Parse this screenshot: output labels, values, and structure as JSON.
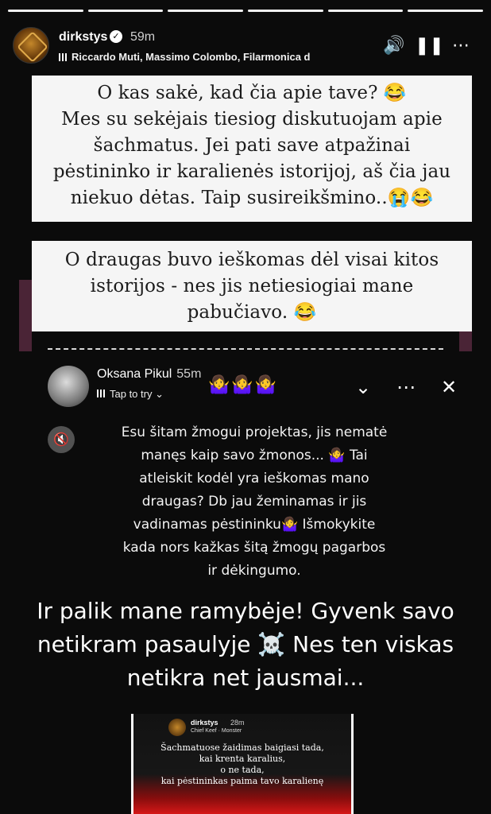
{
  "story": {
    "segments": 6,
    "username": "dirkstys",
    "time": "59m",
    "music": "Riccardo Muti, Massimo Colombo, Filarmonica d",
    "icons": {
      "sound": "volume-icon",
      "pause": "pause-icon",
      "more": "more-icon"
    }
  },
  "card1": [
    "O kas sakė, kad čia apie tave? 😂",
    "Mes su sekėjais tiesiog diskutuojam apie",
    "šachmatus. Jei pati save atpažinai",
    "pėstininko ir karalienės istorijoj, aš čia jau",
    "niekuo dėtas. Taip susireikšmino..😭😂"
  ],
  "card2": [
    "O draugas buvo ieškomas dėl visai kitos",
    "istorijos - nes jis netiesiogiai mane",
    "pabučiavo. 😂"
  ],
  "repost": {
    "username": "Oksana Pikul",
    "time": "55m",
    "emojis": "🤷‍♀️🤷‍♀️🤷‍♀️",
    "tap": "Tap to try",
    "paragraph": [
      "Esu šitam žmogui projektas, jis nematė",
      "manęs kaip savo žmonos... 🤷‍♀️ Tai",
      "atleiskit kodėl yra ieškomas mano",
      "draugas? Db jau žeminamas ir jis",
      "vadinamas pėstininku🤷‍♀️ Išmokykite",
      "kada nors kažkas šitą žmogų pagarbos",
      "ir dėkingumo."
    ],
    "big": [
      "Ir palik mane ramybėje! Gyvenk savo",
      "netikram pasaulyje ☠️ Nes ten viskas",
      "netikra net jausmai..."
    ]
  },
  "thumb": {
    "username": "dirkstys",
    "time": "28m",
    "music": "Chief Keef · Monster",
    "lines": [
      "Šachmatuose žaidimas baigiasi tada,",
      "kai krenta karalius,",
      "o ne tada,",
      "kai pėstininkas paima tavo karalienę"
    ]
  }
}
